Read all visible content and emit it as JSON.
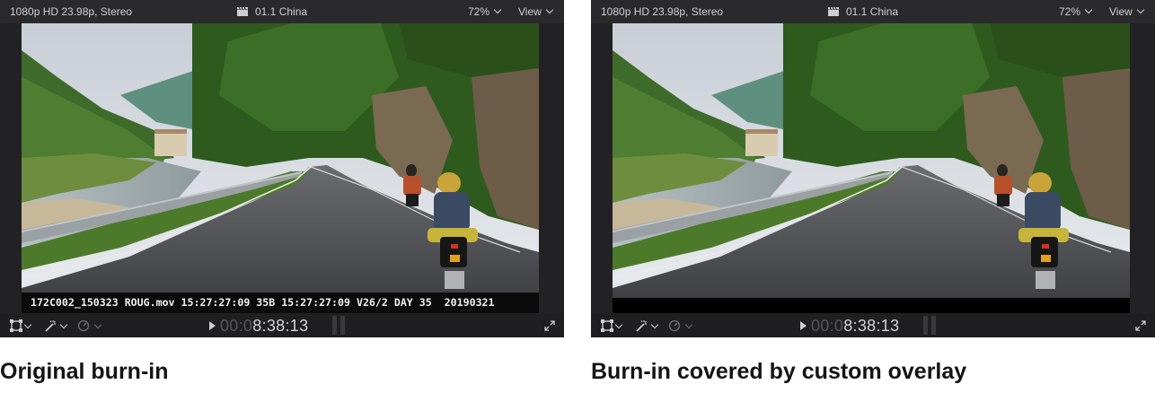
{
  "viewers": [
    {
      "format": "1080p HD 23.98p, Stereo",
      "clip_name": "01.1 China",
      "zoom": "72%",
      "view_menu": "View",
      "timecode_dim": "00:0",
      "timecode_main": "8:38:13",
      "burn_in": "172C002_150323 ROUG.mov 15:27:27:09 35B 15:27:27:09 V26/2 DAY 35  20190321",
      "caption": "Original burn-in"
    },
    {
      "format": "1080p HD 23.98p, Stereo",
      "clip_name": "01.1 China",
      "zoom": "72%",
      "view_menu": "View",
      "timecode_dim": "00:0",
      "timecode_main": "8:38:13",
      "caption": "Burn-in covered by custom overlay"
    }
  ],
  "icons": [
    "clapperboard-icon",
    "transform-icon",
    "magic-wand-icon",
    "speed-gauge-icon",
    "play-icon",
    "fullscreen-icon",
    "chevron-down-icon"
  ],
  "colors": {
    "viewer_bg": "#222224",
    "toolbar_bg": "#2a2a2c",
    "caption_text": "#141414"
  }
}
